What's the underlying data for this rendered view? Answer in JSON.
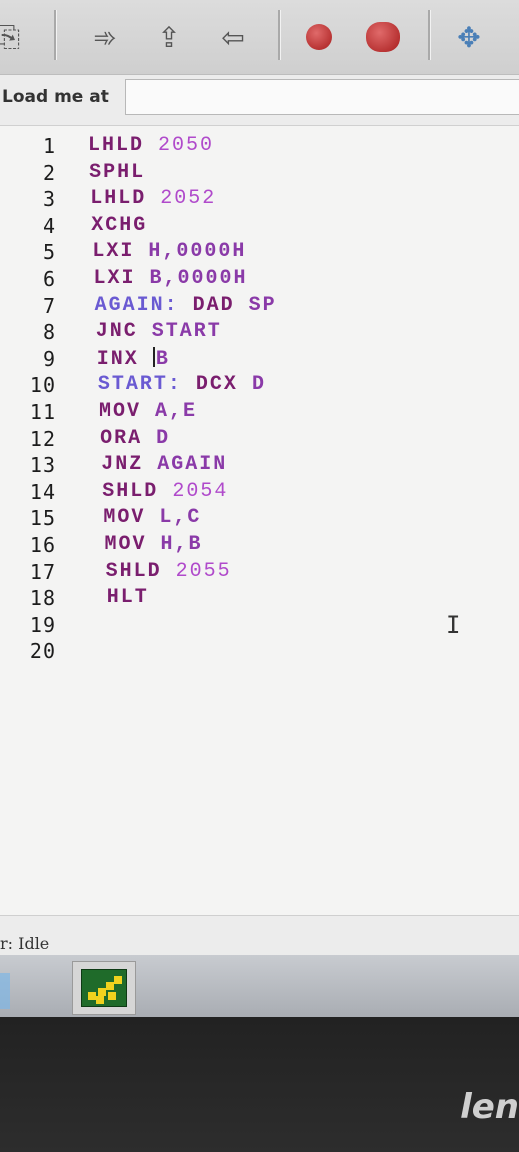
{
  "toolbar": {
    "buttons": [
      {
        "name": "load-icon",
        "glyph": "⎘"
      },
      {
        "name": "step-forward-icon",
        "glyph": "➾"
      },
      {
        "name": "run-icon",
        "glyph": "⇪"
      },
      {
        "name": "step-back-icon",
        "glyph": "⇦"
      },
      {
        "name": "stop-icon",
        "glyph": ""
      },
      {
        "name": "reset-icon",
        "glyph": ""
      },
      {
        "name": "move-icon",
        "glyph": "✥"
      }
    ]
  },
  "load_bar": {
    "label": "Load me at",
    "value": ""
  },
  "editor": {
    "line_numbers": [
      "1",
      "2",
      "3",
      "4",
      "5",
      "6",
      "7",
      "8",
      "9",
      "10",
      "11",
      "12",
      "13",
      "14",
      "15",
      "16",
      "17",
      "18",
      "19",
      "20"
    ],
    "lines": [
      {
        "op": "LHLD",
        "arg": "2050",
        "label": ""
      },
      {
        "op": "SPHL",
        "arg": "",
        "label": ""
      },
      {
        "op": "LHLD",
        "arg": "2052",
        "label": ""
      },
      {
        "op": "XCHG",
        "arg": "",
        "label": ""
      },
      {
        "op": "LXI",
        "arg": "H,0000H",
        "label": ""
      },
      {
        "op": "LXI",
        "arg": "B,0000H",
        "label": ""
      },
      {
        "op": "DAD",
        "arg": "SP",
        "label": "AGAIN:"
      },
      {
        "op": "JNC",
        "arg": "START",
        "label": ""
      },
      {
        "op": "INX",
        "arg": "B",
        "label": ""
      },
      {
        "op": "DCX",
        "arg": "D",
        "label": "START:"
      },
      {
        "op": "MOV",
        "arg": "A,E",
        "label": ""
      },
      {
        "op": "ORA",
        "arg": "D",
        "label": ""
      },
      {
        "op": "JNZ",
        "arg": "AGAIN",
        "label": ""
      },
      {
        "op": "SHLD",
        "arg": "2054",
        "label": ""
      },
      {
        "op": "MOV",
        "arg": "L,C",
        "label": ""
      },
      {
        "op": "MOV",
        "arg": "H,B",
        "label": ""
      },
      {
        "op": "SHLD",
        "arg": "2055",
        "label": ""
      },
      {
        "op": "HLT",
        "arg": "",
        "label": ""
      }
    ]
  },
  "status": {
    "text": "r: Idle"
  },
  "bezel": {
    "brand": "len"
  },
  "colors": {
    "opcode": "#7a1e6e",
    "label": "#6a5ad2",
    "number": "#b04acb",
    "stop": "#a71c1c"
  }
}
